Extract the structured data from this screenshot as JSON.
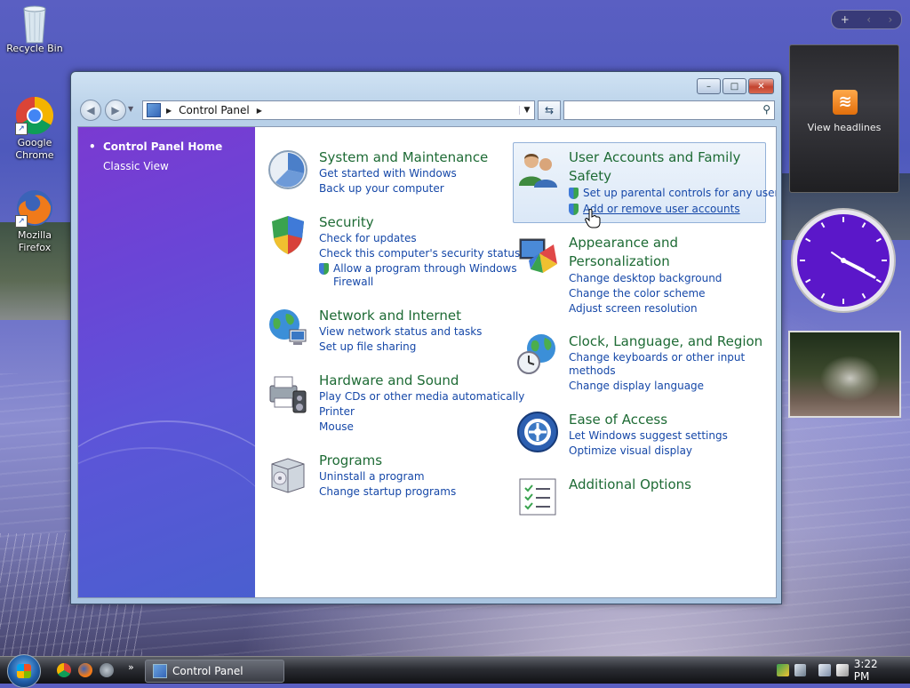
{
  "desktop": {
    "icons": [
      {
        "label": "Recycle Bin",
        "icon": "recycle-bin-icon"
      },
      {
        "label": "Google Chrome",
        "icon": "chrome-icon"
      },
      {
        "label": "Mozilla Firefox",
        "icon": "firefox-icon"
      }
    ]
  },
  "window": {
    "address": {
      "crumb": "Control Panel"
    },
    "search": {
      "placeholder": "",
      "value": ""
    },
    "caption": {
      "minimize": "–",
      "maximize": "□",
      "close": "✕"
    }
  },
  "sidebar": {
    "home": "Control Panel Home",
    "classic": "Classic View"
  },
  "categories_left": [
    {
      "title": "System and Maintenance",
      "icon": "system-maintenance-icon",
      "links": [
        "Get started with Windows",
        "Back up your computer"
      ]
    },
    {
      "title": "Security",
      "icon": "security-shield-icon",
      "links": [
        "Check for updates",
        "Check this computer's security status",
        "Allow a program through Windows",
        "Firewall"
      ]
    },
    {
      "title": "Network and Internet",
      "icon": "network-globe-icon",
      "links": [
        "View network status and tasks",
        "Set up file sharing"
      ]
    },
    {
      "title": "Hardware and Sound",
      "icon": "printer-speaker-icon",
      "links": [
        "Play CDs or other media automatically",
        "Printer",
        "Mouse"
      ]
    },
    {
      "title": "Programs",
      "icon": "programs-box-icon",
      "links": [
        "Uninstall a program",
        "Change startup programs"
      ]
    }
  ],
  "categories_right": [
    {
      "title_line1": "User Accounts and Family",
      "title_line2": "Safety",
      "icon": "user-accounts-icon",
      "links": [
        "Set up parental controls for any user",
        "Add or remove user accounts"
      ]
    },
    {
      "title_line1": "Appearance and",
      "title_line2": "Personalization",
      "icon": "appearance-monitor-icon",
      "links": [
        "Change desktop background",
        "Change the color scheme",
        "Adjust screen resolution"
      ]
    },
    {
      "title": "Clock, Language, and Region",
      "icon": "clock-globe-icon",
      "links": [
        "Change keyboards or other input",
        "methods",
        "Change display language"
      ]
    },
    {
      "title": "Ease of Access",
      "icon": "ease-of-access-icon",
      "links": [
        "Let Windows suggest settings",
        "Optimize visual display"
      ]
    },
    {
      "title": "Additional Options",
      "icon": "additional-options-icon",
      "links": []
    }
  ],
  "gadgets": {
    "toolbar": {
      "add": "+",
      "prev": "‹",
      "next": "›"
    },
    "feeds_label": "View headlines",
    "clock": {
      "hour_hand_deg": 120,
      "minute_hand_deg": 132
    }
  },
  "taskbar": {
    "task_label": "Control Panel",
    "time": "3:22 PM",
    "overflow": "»"
  },
  "colors": {
    "category_title": "#1e6b35",
    "link": "#1648a8",
    "sidebar_top": "#7a3ad1",
    "sidebar_bottom": "#4a5fcf"
  }
}
